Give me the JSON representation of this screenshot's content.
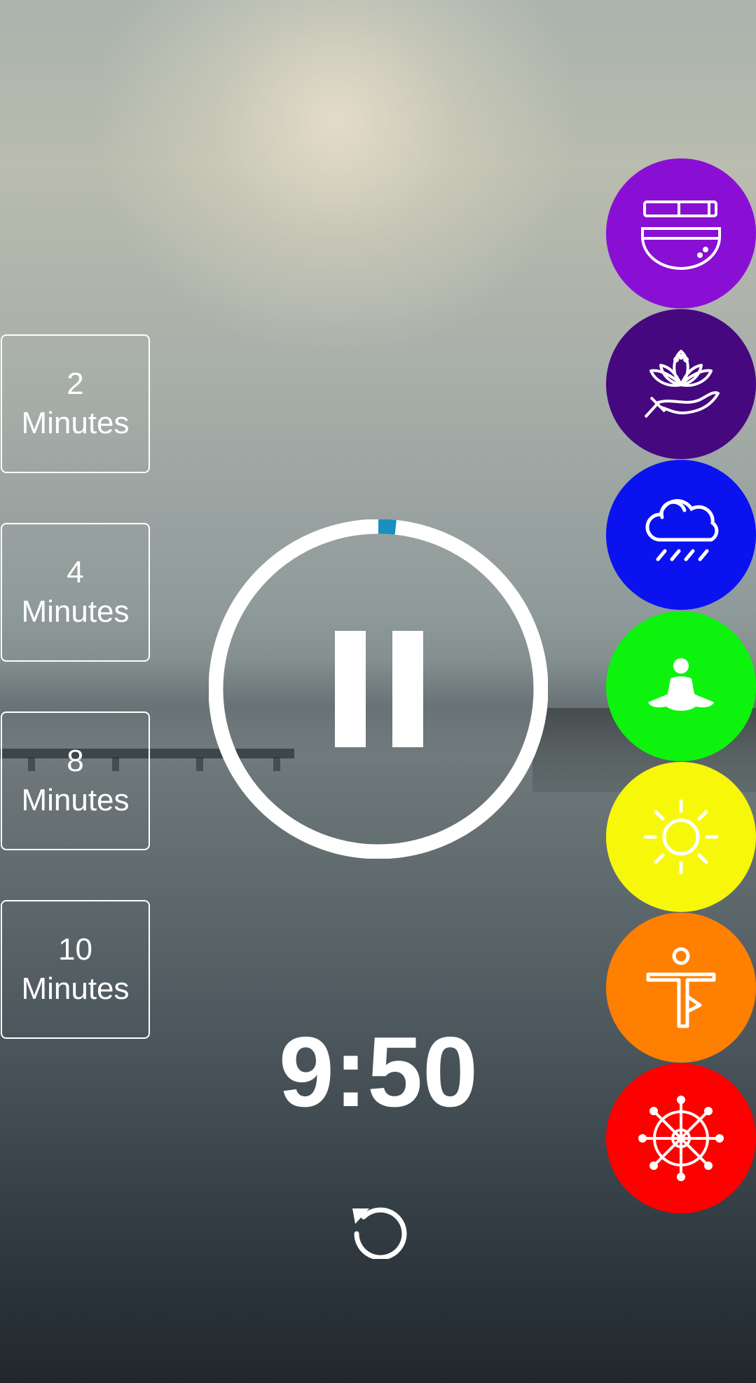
{
  "durations": [
    {
      "number": "2",
      "unit": "Minutes"
    },
    {
      "number": "4",
      "unit": "Minutes"
    },
    {
      "number": "8",
      "unit": "Minutes"
    },
    {
      "number": "10",
      "unit": "Minutes"
    }
  ],
  "timer": {
    "time_display": "9:50",
    "progress_fraction": 0.017,
    "progress_color": "#1a8fc0",
    "state_icon": "pause-icon"
  },
  "controls": {
    "reset_icon": "reset-icon"
  },
  "sounds": [
    {
      "icon": "singing-bowl-icon",
      "color": "#8a0fd4"
    },
    {
      "icon": "lotus-hand-icon",
      "color": "#45087f"
    },
    {
      "icon": "rain-cloud-icon",
      "color": "#0b12f0"
    },
    {
      "icon": "meditation-pose-icon",
      "color": "#0ef30e"
    },
    {
      "icon": "sun-icon",
      "color": "#f7f70a"
    },
    {
      "icon": "yoga-pose-icon",
      "color": "#ff7f00"
    },
    {
      "icon": "dharma-wheel-icon",
      "color": "#fd0000"
    }
  ]
}
